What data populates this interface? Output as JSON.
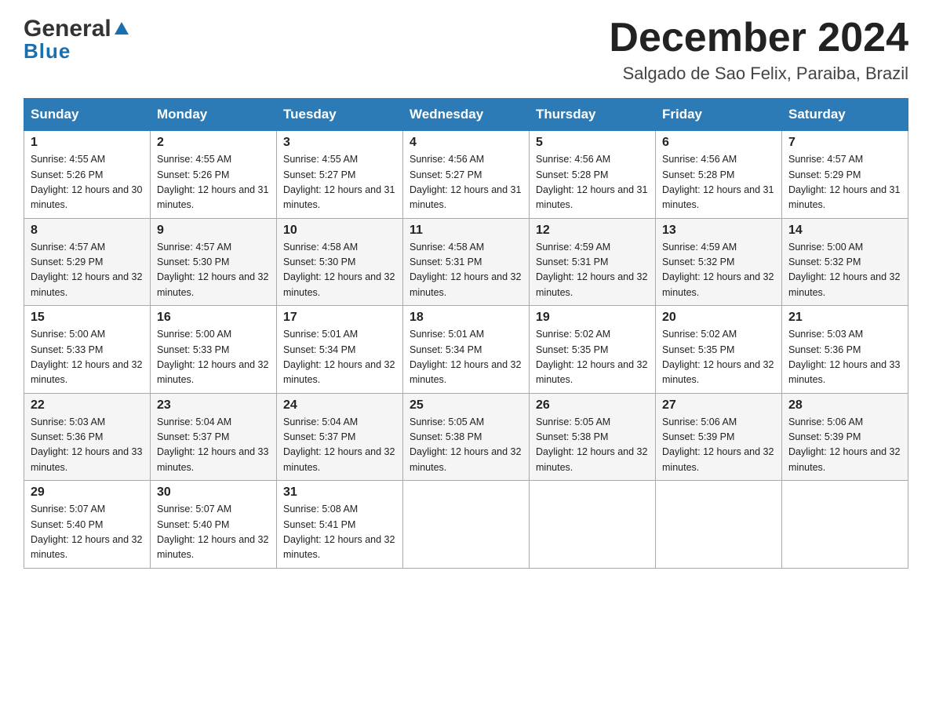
{
  "header": {
    "logo_main": "General",
    "logo_sub": "Blue",
    "title": "December 2024",
    "subtitle": "Salgado de Sao Felix, Paraiba, Brazil"
  },
  "days_of_week": [
    "Sunday",
    "Monday",
    "Tuesday",
    "Wednesday",
    "Thursday",
    "Friday",
    "Saturday"
  ],
  "weeks": [
    [
      {
        "day": "1",
        "sunrise": "4:55 AM",
        "sunset": "5:26 PM",
        "daylight": "12 hours and 30 minutes."
      },
      {
        "day": "2",
        "sunrise": "4:55 AM",
        "sunset": "5:26 PM",
        "daylight": "12 hours and 31 minutes."
      },
      {
        "day": "3",
        "sunrise": "4:55 AM",
        "sunset": "5:27 PM",
        "daylight": "12 hours and 31 minutes."
      },
      {
        "day": "4",
        "sunrise": "4:56 AM",
        "sunset": "5:27 PM",
        "daylight": "12 hours and 31 minutes."
      },
      {
        "day": "5",
        "sunrise": "4:56 AM",
        "sunset": "5:28 PM",
        "daylight": "12 hours and 31 minutes."
      },
      {
        "day": "6",
        "sunrise": "4:56 AM",
        "sunset": "5:28 PM",
        "daylight": "12 hours and 31 minutes."
      },
      {
        "day": "7",
        "sunrise": "4:57 AM",
        "sunset": "5:29 PM",
        "daylight": "12 hours and 31 minutes."
      }
    ],
    [
      {
        "day": "8",
        "sunrise": "4:57 AM",
        "sunset": "5:29 PM",
        "daylight": "12 hours and 32 minutes."
      },
      {
        "day": "9",
        "sunrise": "4:57 AM",
        "sunset": "5:30 PM",
        "daylight": "12 hours and 32 minutes."
      },
      {
        "day": "10",
        "sunrise": "4:58 AM",
        "sunset": "5:30 PM",
        "daylight": "12 hours and 32 minutes."
      },
      {
        "day": "11",
        "sunrise": "4:58 AM",
        "sunset": "5:31 PM",
        "daylight": "12 hours and 32 minutes."
      },
      {
        "day": "12",
        "sunrise": "4:59 AM",
        "sunset": "5:31 PM",
        "daylight": "12 hours and 32 minutes."
      },
      {
        "day": "13",
        "sunrise": "4:59 AM",
        "sunset": "5:32 PM",
        "daylight": "12 hours and 32 minutes."
      },
      {
        "day": "14",
        "sunrise": "5:00 AM",
        "sunset": "5:32 PM",
        "daylight": "12 hours and 32 minutes."
      }
    ],
    [
      {
        "day": "15",
        "sunrise": "5:00 AM",
        "sunset": "5:33 PM",
        "daylight": "12 hours and 32 minutes."
      },
      {
        "day": "16",
        "sunrise": "5:00 AM",
        "sunset": "5:33 PM",
        "daylight": "12 hours and 32 minutes."
      },
      {
        "day": "17",
        "sunrise": "5:01 AM",
        "sunset": "5:34 PM",
        "daylight": "12 hours and 32 minutes."
      },
      {
        "day": "18",
        "sunrise": "5:01 AM",
        "sunset": "5:34 PM",
        "daylight": "12 hours and 32 minutes."
      },
      {
        "day": "19",
        "sunrise": "5:02 AM",
        "sunset": "5:35 PM",
        "daylight": "12 hours and 32 minutes."
      },
      {
        "day": "20",
        "sunrise": "5:02 AM",
        "sunset": "5:35 PM",
        "daylight": "12 hours and 32 minutes."
      },
      {
        "day": "21",
        "sunrise": "5:03 AM",
        "sunset": "5:36 PM",
        "daylight": "12 hours and 33 minutes."
      }
    ],
    [
      {
        "day": "22",
        "sunrise": "5:03 AM",
        "sunset": "5:36 PM",
        "daylight": "12 hours and 33 minutes."
      },
      {
        "day": "23",
        "sunrise": "5:04 AM",
        "sunset": "5:37 PM",
        "daylight": "12 hours and 33 minutes."
      },
      {
        "day": "24",
        "sunrise": "5:04 AM",
        "sunset": "5:37 PM",
        "daylight": "12 hours and 32 minutes."
      },
      {
        "day": "25",
        "sunrise": "5:05 AM",
        "sunset": "5:38 PM",
        "daylight": "12 hours and 32 minutes."
      },
      {
        "day": "26",
        "sunrise": "5:05 AM",
        "sunset": "5:38 PM",
        "daylight": "12 hours and 32 minutes."
      },
      {
        "day": "27",
        "sunrise": "5:06 AM",
        "sunset": "5:39 PM",
        "daylight": "12 hours and 32 minutes."
      },
      {
        "day": "28",
        "sunrise": "5:06 AM",
        "sunset": "5:39 PM",
        "daylight": "12 hours and 32 minutes."
      }
    ],
    [
      {
        "day": "29",
        "sunrise": "5:07 AM",
        "sunset": "5:40 PM",
        "daylight": "12 hours and 32 minutes."
      },
      {
        "day": "30",
        "sunrise": "5:07 AM",
        "sunset": "5:40 PM",
        "daylight": "12 hours and 32 minutes."
      },
      {
        "day": "31",
        "sunrise": "5:08 AM",
        "sunset": "5:41 PM",
        "daylight": "12 hours and 32 minutes."
      },
      null,
      null,
      null,
      null
    ]
  ]
}
